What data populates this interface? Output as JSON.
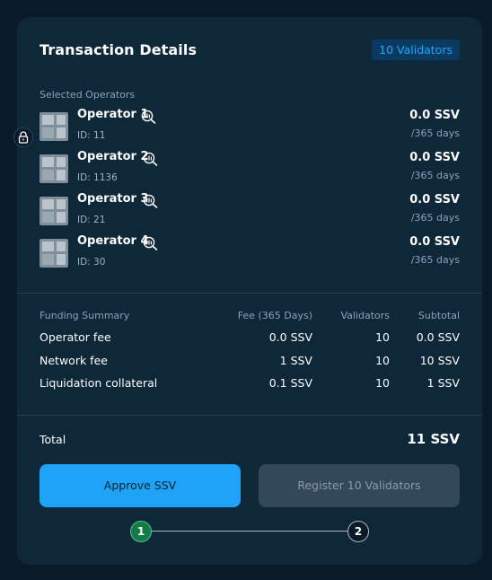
{
  "title": "Transaction Details",
  "validators_badge": "10 Validators",
  "selected_operators_label": "Selected Operators",
  "operators": [
    {
      "name": "Operator 1",
      "id": "ID: 11",
      "fee": "0.0 SSV",
      "period": "/365 days"
    },
    {
      "name": "Operator 2",
      "id": "ID: 1136",
      "fee": "0.0 SSV",
      "period": "/365 days"
    },
    {
      "name": "Operator 3",
      "id": "ID: 21",
      "fee": "0.0 SSV",
      "period": "/365 days"
    },
    {
      "name": "Operator 4",
      "id": "ID: 30",
      "fee": "0.0 SSV",
      "period": "/365 days"
    }
  ],
  "funding_summary": {
    "headers": [
      "Funding Summary",
      "Fee (365 Days)",
      "Validators",
      "Subtotal"
    ],
    "rows": [
      {
        "label": "Operator fee",
        "fee": "0.0 SSV",
        "validators": "10",
        "subtotal": "0.0 SSV"
      },
      {
        "label": "Network fee",
        "fee": "1 SSV",
        "validators": "10",
        "subtotal": "10 SSV"
      },
      {
        "label": "Liquidation collateral",
        "fee": "0.1 SSV",
        "validators": "10",
        "subtotal": "1 SSV"
      }
    ]
  },
  "total": {
    "label": "Total",
    "value": "11 SSV"
  },
  "buttons": {
    "approve": "Approve SSV",
    "register": "Register 10 Validators"
  },
  "steps": [
    "1",
    "2"
  ],
  "icons": {
    "operator_action": "analytics-search-icon",
    "lock": "lock-icon"
  },
  "colors": {
    "accent": "#1ea3f6",
    "step_done": "#157a49",
    "disabled": "#34485c"
  }
}
